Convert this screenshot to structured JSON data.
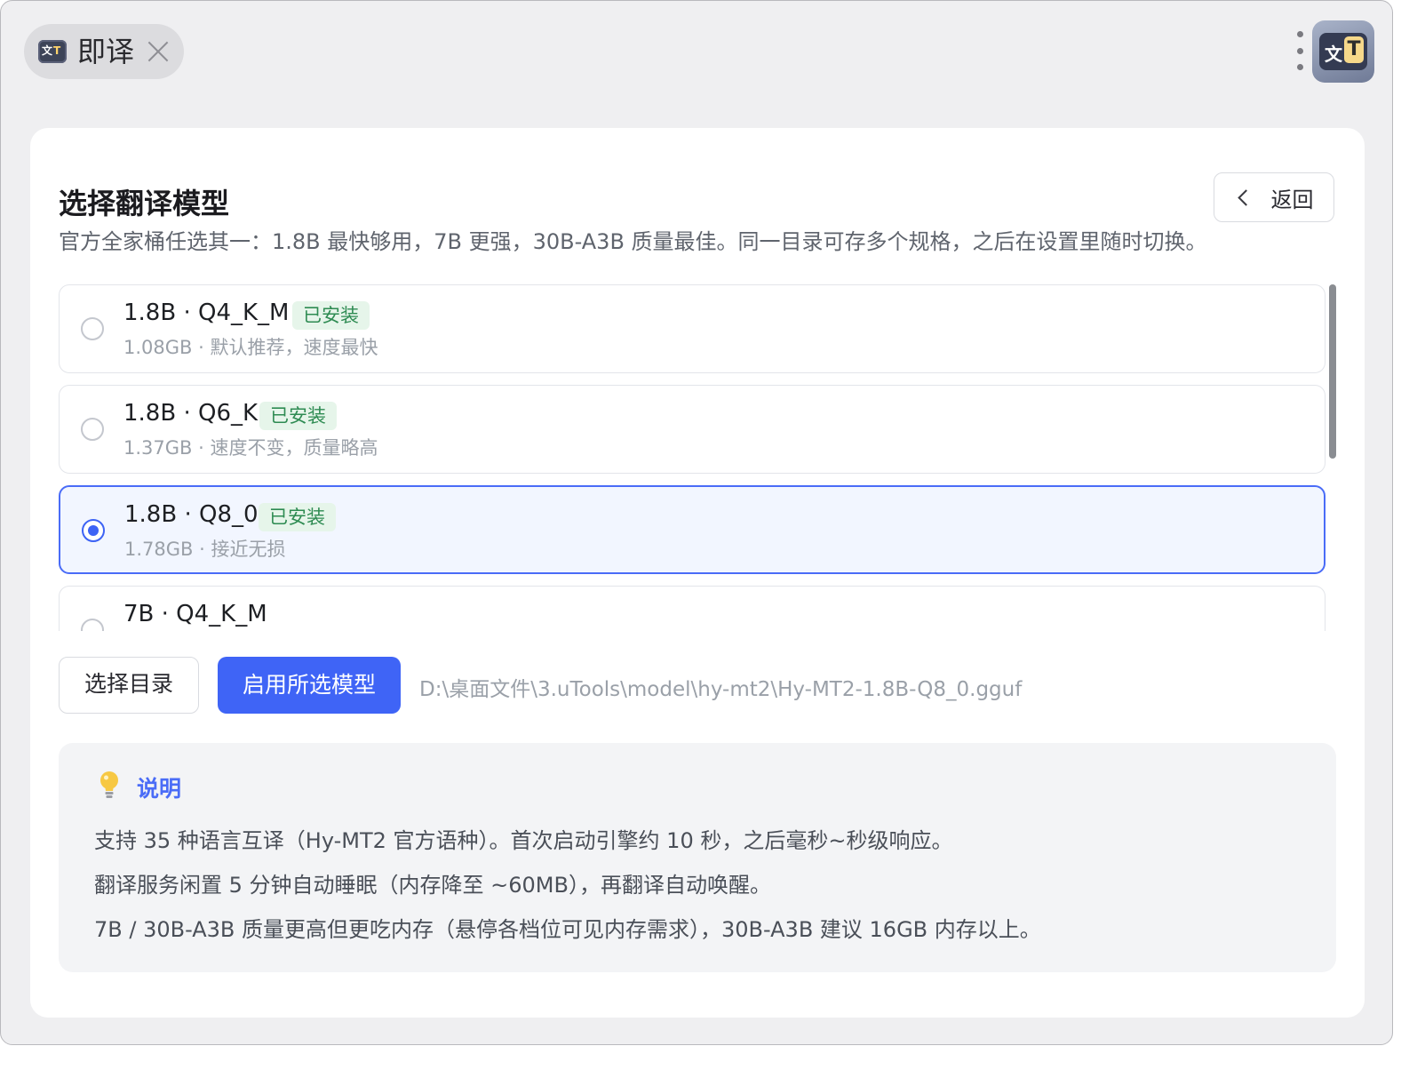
{
  "tab": {
    "title": "即译"
  },
  "icons": {
    "close": "close-icon",
    "more": "more-vertical-icon",
    "app_logo": "app-logo-icon",
    "back": "chevron-left-icon",
    "bulb": "lightbulb-icon"
  },
  "logo": {
    "glyph_left": "文",
    "glyph_right": "T"
  },
  "page": {
    "title": "选择翻译模型",
    "subtitle": "官方全家桶任选其一：1.8B 最快够用，7B 更强，30B-A3B 质量最佳。同一目录可存多个规格，之后在设置里随时切换。",
    "back_label": "返回"
  },
  "models": [
    {
      "name": "1.8B · Q4_K_M",
      "badge": "已安装",
      "desc": "1.08GB · 默认推荐，速度最快",
      "selected": false
    },
    {
      "name": "1.8B · Q6_K",
      "badge": "已安装",
      "desc": "1.37GB · 速度不变，质量略高",
      "selected": false
    },
    {
      "name": "1.8B · Q8_0",
      "badge": "已安装",
      "desc": "1.78GB · 接近无损",
      "selected": true
    },
    {
      "name": "7B · Q4_K_M",
      "badge": "",
      "desc": "",
      "selected": false
    }
  ],
  "actions": {
    "choose_dir": "选择目录",
    "apply": "启用所选模型",
    "path": "D:\\桌面文件\\3.uTools\\model\\hy-mt2\\Hy-MT2-1.8B-Q8_0.gguf"
  },
  "notes": {
    "title": "说明",
    "lines": [
      "支持 35 种语言互译（Hy-MT2 官方语种）。首次启动引擎约 10 秒，之后毫秒~秒级响应。",
      "翻译服务闲置 5 分钟自动睡眠（内存降至 ~60MB），再翻译自动唤醒。",
      "7B / 30B-A3B 质量更高但更吃内存（悬停各档位可见内存需求），30B-A3B 建议 16GB 内存以上。"
    ]
  },
  "colors": {
    "accent": "#3f64f6",
    "installed_bg": "#e6f5ea",
    "installed_fg": "#2e8b52",
    "notes_title": "#4a6cf7"
  }
}
